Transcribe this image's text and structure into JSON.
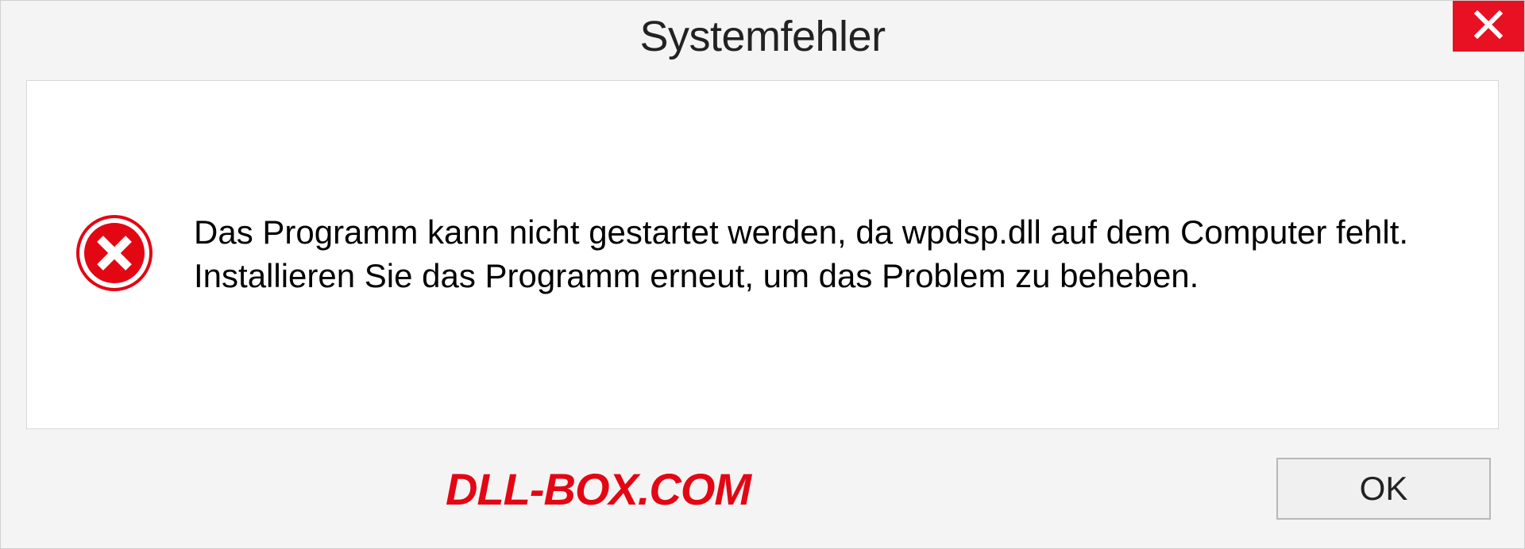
{
  "dialog": {
    "title": "Systemfehler",
    "message": "Das Programm kann nicht gestartet werden, da wpdsp.dll auf dem Computer fehlt. Installieren Sie das Programm erneut, um das Problem zu beheben.",
    "ok_label": "OK"
  },
  "watermark": {
    "text": "DLL-BOX.COM"
  }
}
